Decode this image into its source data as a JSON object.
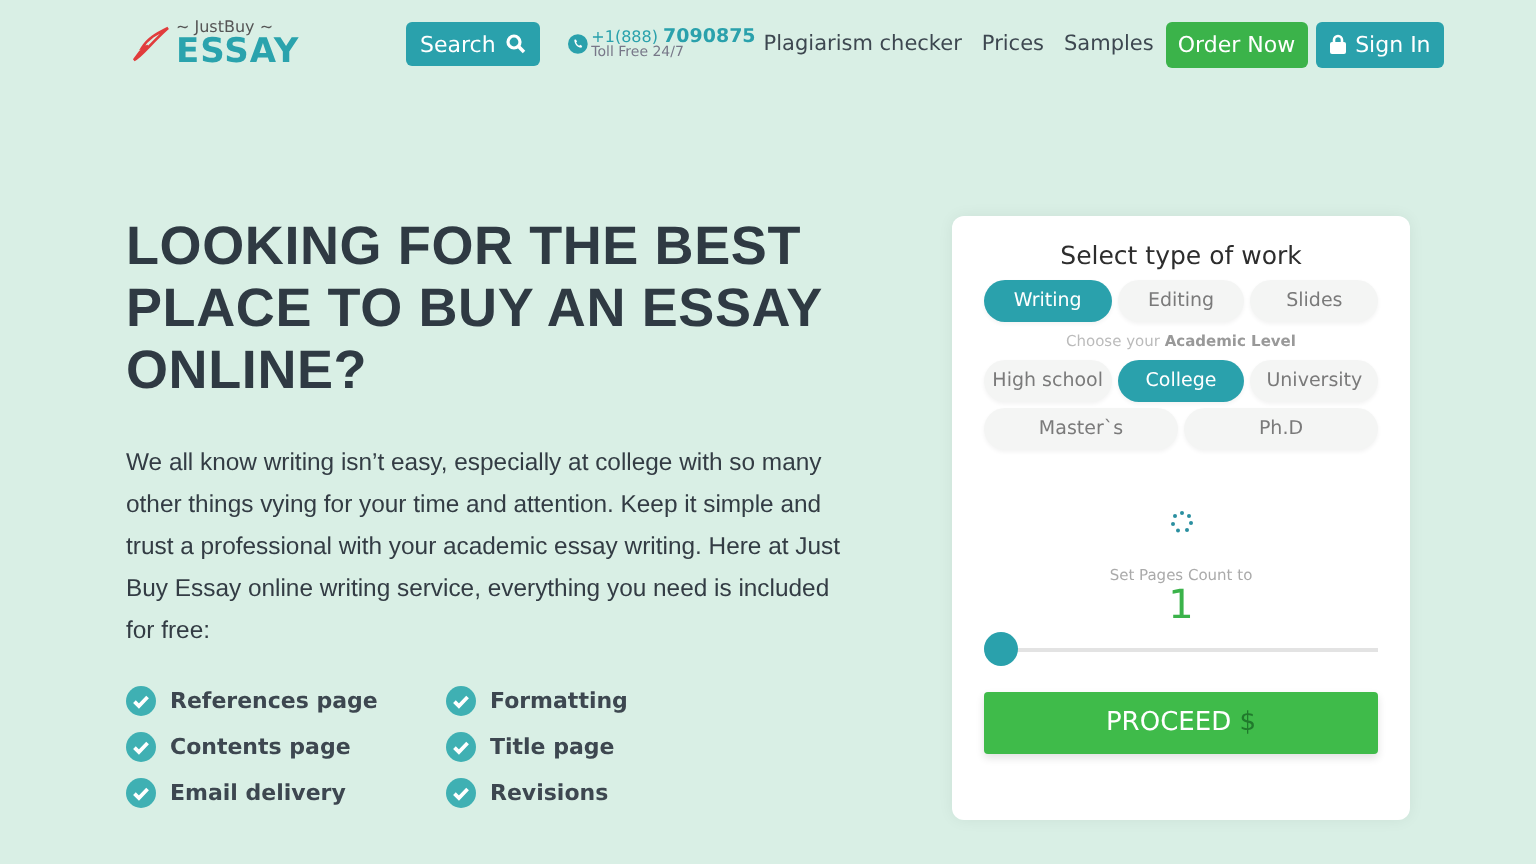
{
  "header": {
    "logo": {
      "top": "~ JustBuy ~",
      "main": "ESSAY"
    },
    "search_button": "Search",
    "phone": {
      "number_prefix": "+1(888)",
      "number": "7090875",
      "note": "Toll Free 24/7"
    },
    "nav": [
      "Plagiarism checker",
      "Prices",
      "Samples"
    ],
    "order_button": "Order Now",
    "signin_button": "Sign In"
  },
  "hero": {
    "heading": "LOOKING FOR THE BEST PLACE TO BUY AN ESSAY ONLINE?",
    "paragraph": "We all know writing isn’t easy, especially at college with so many other things vying for your time and attention. Keep it simple and trust a professional with your academic essay writing. Here at Just Buy Essay online writing service, everything you need is included for free:",
    "features": [
      {
        "label": "References page",
        "checked": true
      },
      {
        "label": "Formatting",
        "checked": true
      },
      {
        "label": "Contents page",
        "checked": true
      },
      {
        "label": "Title page",
        "checked": true
      },
      {
        "label": "Email delivery",
        "checked": true
      },
      {
        "label": "Revisions",
        "checked": true
      }
    ]
  },
  "order_card": {
    "title": "Select type of work",
    "work_types": [
      {
        "label": "Writing",
        "selected": true
      },
      {
        "label": "Editing",
        "selected": false
      },
      {
        "label": "Slides",
        "selected": false
      }
    ],
    "level_prompt": "Choose your **Academic Level**",
    "levels": [
      {
        "label": "High school",
        "selected": false
      },
      {
        "label": "College",
        "selected": true
      },
      {
        "label": "University",
        "selected": false
      },
      {
        "label": "Master`s",
        "selected": false
      },
      {
        "label": "Ph.D",
        "selected": false
      }
    ],
    "pages_label": "Set Pages Count to",
    "pages_value": "1",
    "pages_slider": {
      "level": 0
    },
    "proceed": {
      "label": "PROCEED",
      "currency": "$"
    }
  }
}
